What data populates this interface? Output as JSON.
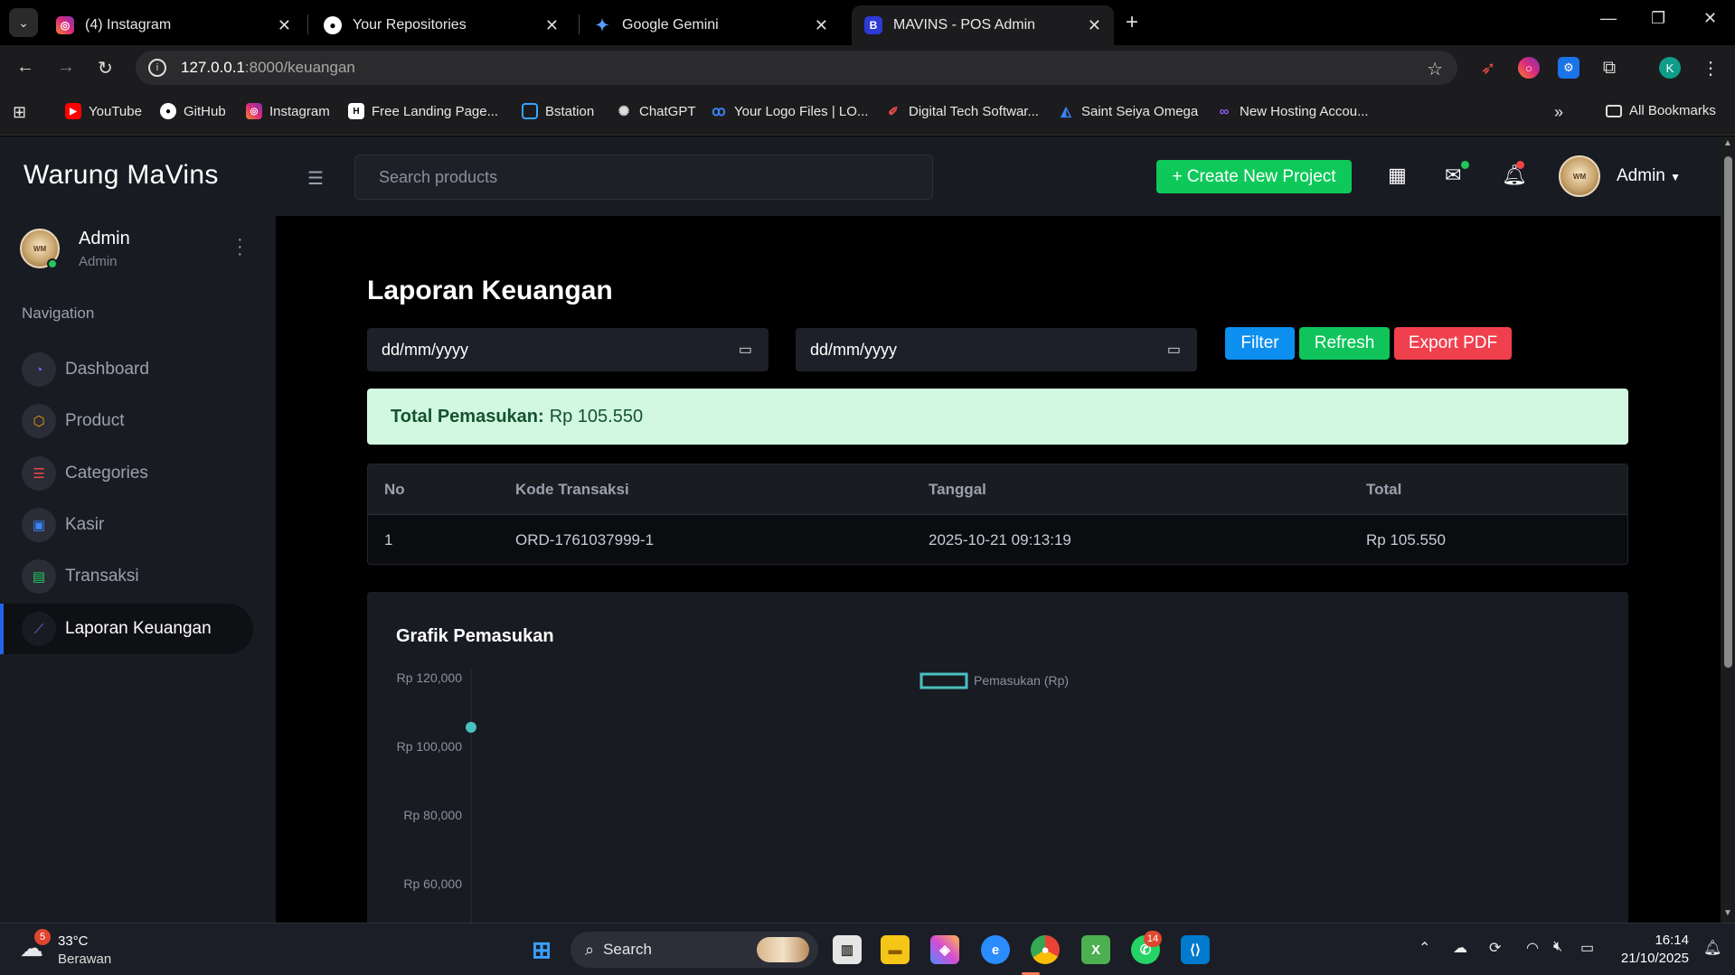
{
  "browser": {
    "tabs": [
      {
        "title": "(4) Instagram",
        "icon": "instagram-icon",
        "color": "#e1306c"
      },
      {
        "title": "Your Repositories",
        "icon": "github-icon",
        "color": "#333333"
      },
      {
        "title": "Google Gemini",
        "icon": "gemini-icon",
        "color": "#4285f4"
      },
      {
        "title": "MAVINS - POS Admin",
        "icon": "mavins-icon",
        "color": "#2c3bd6"
      }
    ],
    "url_host": "127.0.0.1",
    "url_path": ":8000/keuangan",
    "bookmarks": [
      "YouTube",
      "GitHub",
      "Instagram",
      "Free Landing Page...",
      "Bstation",
      "ChatGPT",
      "Your Logo Files | LO...",
      "Digital Tech Softwar...",
      "Saint Seiya Omega",
      "New Hosting Accou..."
    ],
    "all_bookmarks": "All Bookmarks",
    "profile_initial": "K"
  },
  "app": {
    "brand": "Warung MaVins",
    "user": {
      "name": "Admin",
      "role": "Admin"
    },
    "nav_title": "Navigation",
    "nav": [
      {
        "label": "Dashboard",
        "icon": "gauge-icon",
        "color": "#8b5cf6"
      },
      {
        "label": "Product",
        "icon": "box-icon",
        "color": "#f59e0b"
      },
      {
        "label": "Categories",
        "icon": "list-icon",
        "color": "#ef4444"
      },
      {
        "label": "Kasir",
        "icon": "cash-icon",
        "color": "#3b82f6"
      },
      {
        "label": "Transaksi",
        "icon": "receipt-icon",
        "color": "#22c55e"
      },
      {
        "label": "Laporan Keuangan",
        "icon": "chart-line-icon",
        "color": "#8b5cf6"
      }
    ],
    "search_placeholder": "Search products",
    "create_button": "+ Create New Project",
    "admin_name": "Admin"
  },
  "page": {
    "title": "Laporan Keuangan",
    "date_from_placeholder": "dd/mm/yyyy",
    "date_to_placeholder": "dd/mm/yyyy",
    "buttons": {
      "filter": "Filter",
      "refresh": "Refresh",
      "export": "Export PDF"
    },
    "colors": {
      "filter": "#0d8ff0",
      "refresh": "#10c45b",
      "export": "#f0404e"
    },
    "summary_label": "Total Pemasukan:",
    "summary_value": "Rp 105.550",
    "table": {
      "headers": [
        "No",
        "Kode Transaksi",
        "Tanggal",
        "Total"
      ],
      "rows": [
        [
          "1",
          "ORD-1761037999-1",
          "2025-10-21 09:13:19",
          "Rp 105.550"
        ]
      ]
    },
    "chart_title": "Grafik Pemasukan"
  },
  "chart_data": {
    "type": "line",
    "title": "Grafik Pemasukan",
    "series": [
      {
        "name": "Pemasukan (Rp)",
        "values": [
          105550
        ],
        "color": "#4bc0c0"
      }
    ],
    "y_ticks": [
      "Rp 120,000",
      "Rp 100,000",
      "Rp 80,000",
      "Rp 60,000"
    ],
    "legend_position": "top-center"
  },
  "taskbar": {
    "weather_temp": "33°C",
    "weather_desc": "Berawan",
    "weather_badge": "5",
    "search_label": "Search",
    "whatsapp_badge": "14",
    "time": "16:14",
    "date": "21/10/2025"
  }
}
